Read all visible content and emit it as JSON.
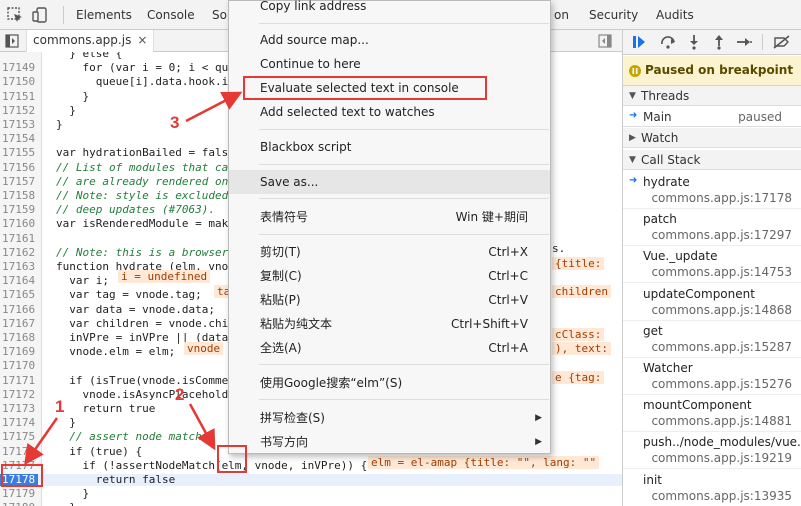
{
  "devtools": {
    "top_tabs": [
      "Elements",
      "Console",
      "So",
      "on",
      "Security",
      "Audits"
    ],
    "file_tab": {
      "name": "commons.app.js",
      "close": "×"
    }
  },
  "code": {
    "lines": [
      {
        "n": "",
        "t": "  } else {"
      },
      {
        "n": "17149",
        "t": "    for (var i = 0; i < qu"
      },
      {
        "n": "17150",
        "t": "      queue[i].data.hook.i"
      },
      {
        "n": "17151",
        "t": "    }"
      },
      {
        "n": "17152",
        "t": "  }"
      },
      {
        "n": "17153",
        "t": "}"
      },
      {
        "n": "17154",
        "t": ""
      },
      {
        "n": "17155",
        "t": "var hydrationBailed = fals"
      },
      {
        "n": "17156",
        "t": "// List of modules that ca"
      },
      {
        "n": "17157",
        "t": "// are already rendered on"
      },
      {
        "n": "17158",
        "t": "// Note: style is excluded"
      },
      {
        "n": "17159",
        "t": "// deep updates (#7063)."
      },
      {
        "n": "17160",
        "t": "var isRenderedModule = mak"
      },
      {
        "n": "17161",
        "t": ""
      },
      {
        "n": "17162",
        "t": "// Note: this is a browser"
      },
      {
        "n": "17163",
        "t": "function hydrate (elm, vno"
      },
      {
        "n": "17164",
        "t": "  var i;"
      },
      {
        "n": "17165",
        "t": "  var tag = vnode.tag;"
      },
      {
        "n": "17166",
        "t": "  var data = vnode.data;"
      },
      {
        "n": "17167",
        "t": "  var children = vnode.chi"
      },
      {
        "n": "17168",
        "t": "  inVPre = inVPre || (data"
      },
      {
        "n": "17169",
        "t": "  vnode.elm = elm;"
      },
      {
        "n": "17170",
        "t": ""
      },
      {
        "n": "17171",
        "t": "  if (isTrue(vnode.isComme"
      },
      {
        "n": "17172",
        "t": "    vnode.isAsyncPlacehold"
      },
      {
        "n": "17173",
        "t": "    return true"
      },
      {
        "n": "17174",
        "t": "  }"
      },
      {
        "n": "17175",
        "t": "  // assert node match"
      },
      {
        "n": "17176",
        "t": "  if (true) {"
      },
      {
        "n": "17177",
        "t": "    if (!assertNodeMatch(elm, vnode, inVPre)) {"
      },
      {
        "n": "17178",
        "t": "      return false"
      },
      {
        "n": "17179",
        "t": "    }"
      },
      {
        "n": "17180",
        "t": "  }"
      }
    ],
    "inline_values": {
      "i_undefined": "i = undefined",
      "tag": "ta",
      "vnode": "vnode",
      "title": "{title:",
      "children": "children",
      "cclass": "cClass:",
      "text": "), text:",
      "tag2": "e {tag:",
      "elm_amap": "elm = el-amap {title: \"\", lang: \"\"",
      "s_dot": "s."
    }
  },
  "context_menu": {
    "items": [
      {
        "label": "Copy link address",
        "shortcut": ""
      },
      {
        "label": "Add source map...",
        "shortcut": ""
      },
      {
        "label": "Continue to here",
        "shortcut": ""
      },
      {
        "label": "Evaluate selected text in console",
        "shortcut": ""
      },
      {
        "label": "Add selected text to watches",
        "shortcut": ""
      },
      {
        "label": "Blackbox script",
        "shortcut": ""
      },
      {
        "label": "Save as...",
        "shortcut": ""
      },
      {
        "label": "表情符号",
        "shortcut": "Win 键+期间"
      },
      {
        "label": "剪切(T)",
        "shortcut": "Ctrl+X"
      },
      {
        "label": "复制(C)",
        "shortcut": "Ctrl+C"
      },
      {
        "label": "粘贴(P)",
        "shortcut": "Ctrl+V"
      },
      {
        "label": "粘贴为纯文本",
        "shortcut": "Ctrl+Shift+V"
      },
      {
        "label": "全选(A)",
        "shortcut": "Ctrl+A"
      },
      {
        "label": "使用Google搜索“elm”(S)",
        "shortcut": ""
      },
      {
        "label": "拼写检查(S)",
        "shortcut": ""
      },
      {
        "label": "书写方向",
        "shortcut": ""
      }
    ]
  },
  "debugger": {
    "paused_text": "Paused on breakpoint",
    "threads_label": "Threads",
    "main_thread": "Main",
    "main_status": "paused",
    "watch_label": "Watch",
    "call_stack_label": "Call Stack",
    "frames": [
      {
        "fn": "hydrate",
        "loc": "commons.app.js:17178"
      },
      {
        "fn": "patch",
        "loc": "commons.app.js:17297"
      },
      {
        "fn": "Vue._update",
        "loc": "commons.app.js:14753"
      },
      {
        "fn": "updateComponent",
        "loc": "commons.app.js:14868"
      },
      {
        "fn": "get",
        "loc": "commons.app.js:15287"
      },
      {
        "fn": "Watcher",
        "loc": "commons.app.js:15276"
      },
      {
        "fn": "mountComponent",
        "loc": "commons.app.js:14881"
      },
      {
        "fn": "push../node_modules/vue...",
        "loc": "commons.app.js:19219"
      },
      {
        "fn": "init",
        "loc": "commons.app.js:13935"
      }
    ]
  },
  "annotations": {
    "one": "1",
    "two": "2",
    "three": "3"
  },
  "colors": {
    "annotation": "#e53935",
    "breakpoint": "#3b7ddd",
    "paused_bg": "#fcf4d0"
  }
}
